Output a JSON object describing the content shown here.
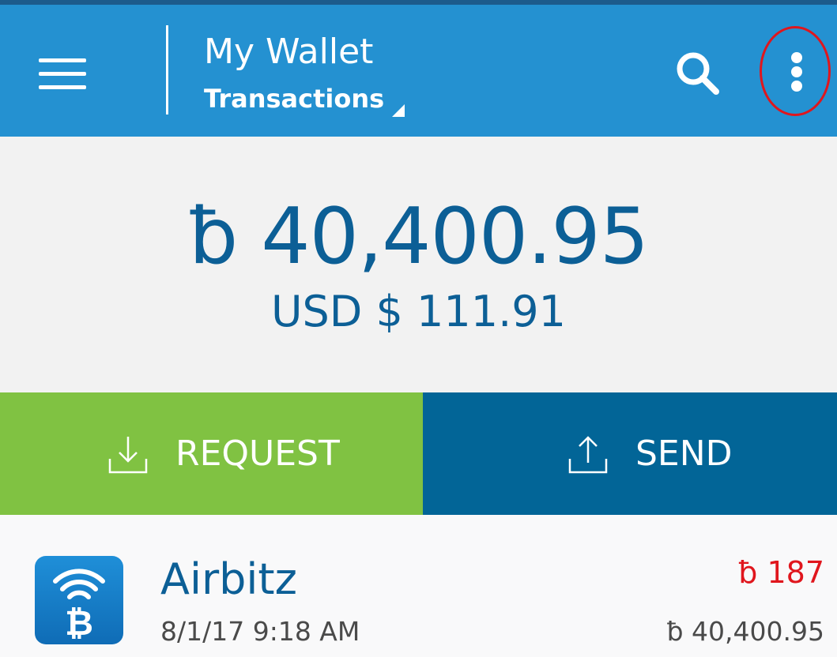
{
  "header": {
    "wallet_name": "My Wallet",
    "view_label": "Transactions",
    "menu_icon": "hamburger-menu-icon",
    "search_icon": "search-icon",
    "more_icon": "more-vertical-icon"
  },
  "balance": {
    "btc": "ƀ 40,400.95",
    "fiat": "USD $ 111.91"
  },
  "actions": {
    "request_label": "REQUEST",
    "send_label": "SEND"
  },
  "transactions": [
    {
      "name": "Airbitz",
      "date": "8/1/17 9:18 AM",
      "amount": "ƀ 187",
      "running_balance": "ƀ 40,400.95"
    }
  ],
  "colors": {
    "appbar": "#2491d1",
    "top_strip": "#1c5b8c",
    "request_button": "#80c242",
    "send_button": "#026597",
    "primary_text": "#0c5f96",
    "negative_amount": "#e0161d",
    "highlight_ring": "#e0161d"
  }
}
